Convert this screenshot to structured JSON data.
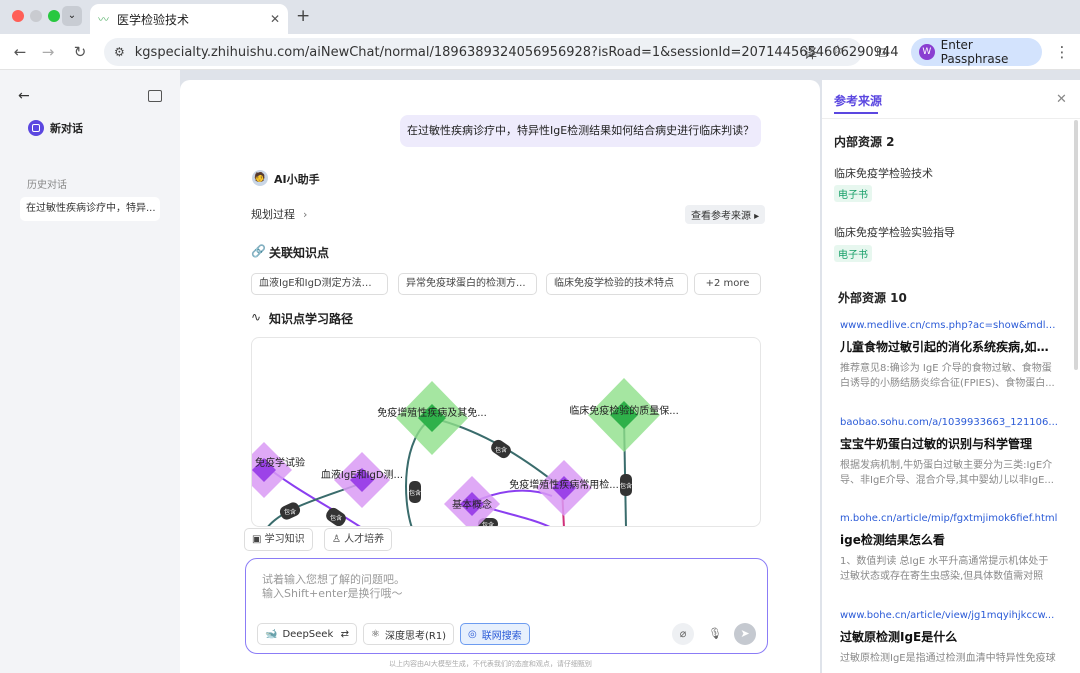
{
  "browser": {
    "tab_title": "医学检验技术",
    "url": "kgspecialty.zhihuishu.com/aiNewChat/normal/1896389324056956928?isRoad=1&sessionId=2071445654606290944",
    "passphrase_label": "Enter Passphrase",
    "passphrase_icon_letter": "W"
  },
  "sidebar": {
    "new_chat_label": "新对话",
    "history_heading": "历史对话",
    "history_items": [
      "在过敏性疾病诊疗中，特异..."
    ]
  },
  "chat": {
    "user_question": "在过敏性疾病诊疗中，特异性IgE检测结果如何结合病史进行临床判读？",
    "assistant_name": "AI小助手",
    "planning_label": "规划过程",
    "view_sources_label": "查看参考来源",
    "related_heading": "关联知识点",
    "related_chips": [
      "血液IgE和IgD测定方法及...",
      "异常免疫球蛋白的检测方...",
      "临床免疫学检验的技术特点"
    ],
    "more_label": "+2 more",
    "path_heading": "知识点学习路径",
    "graph": {
      "nodes": [
        "免疫增殖性疾病及其免...",
        "临床免疫检验的质量保...",
        "免疫增殖性疾病常用检...",
        "基本概念",
        "血液IgE和IgD测...",
        "免疫学试验"
      ],
      "edge_labels": [
        "包含",
        "包含",
        "包含",
        "包含",
        "包含",
        "包含",
        "包含"
      ]
    }
  },
  "composer": {
    "quick_actions": [
      "学习知识",
      "人才培养"
    ],
    "placeholder_line1": "试着输入您想了解的问题吧。",
    "placeholder_line2": "输入Shift+enter是换行哦～",
    "model_label": "DeepSeek",
    "deep_think_label": "深度思考(R1)",
    "web_search_label": "联网搜索",
    "disclaimer": "以上内容由AI大模型生成，不代表我们的态度和观点，请仔细甄别"
  },
  "sources": {
    "tab_label": "参考来源",
    "internal_heading": "内部资源 2",
    "internal": [
      {
        "title": "临床免疫学检验技术",
        "tag": "电子书"
      },
      {
        "title": "临床免疫学检验实验指导",
        "tag": "电子书"
      }
    ],
    "external_heading": "外部资源 10",
    "external": [
      {
        "link": "www.medlive.cn/cms.php?ac=show&mdl=i...",
        "title": "儿童食物过敏引起的消化系统疾病,如何进...",
        "desc": "推荐意见8:确诊为 IgE 介导的食物过敏、食物蛋白诱导的小肠结肠炎综合征(FPIES)、食物蛋白..."
      },
      {
        "link": "baobao.sohu.com/a/1039933663_121106...",
        "title": "宝宝牛奶蛋白过敏的识别与科学管理",
        "desc": "根据发病机制,牛奶蛋白过敏主要分为三类:IgE介导、非IgE介导、混合介导,其中婴幼儿以非IgE..."
      },
      {
        "link": "m.bohe.cn/article/mip/fgxtmjimok6fief.html",
        "title": "ige检测结果怎么看",
        "desc": "1、数值判读 总IgE 水平升高通常提示机体处于过敏状态或存在寄生虫感染,但具体数值需对照检..."
      },
      {
        "link": "www.bohe.cn/article/view/jg1mqyihjkccw...",
        "title": "过敏原检测IgE是什么",
        "desc": "过敏原检测IgE是指通过检测血清中特异性免疫球"
      }
    ]
  },
  "colors": {
    "accent": "#5b47e0",
    "link": "#2b5bd7",
    "node_green": "#4ccf5a",
    "node_purple": "#c77df2"
  }
}
